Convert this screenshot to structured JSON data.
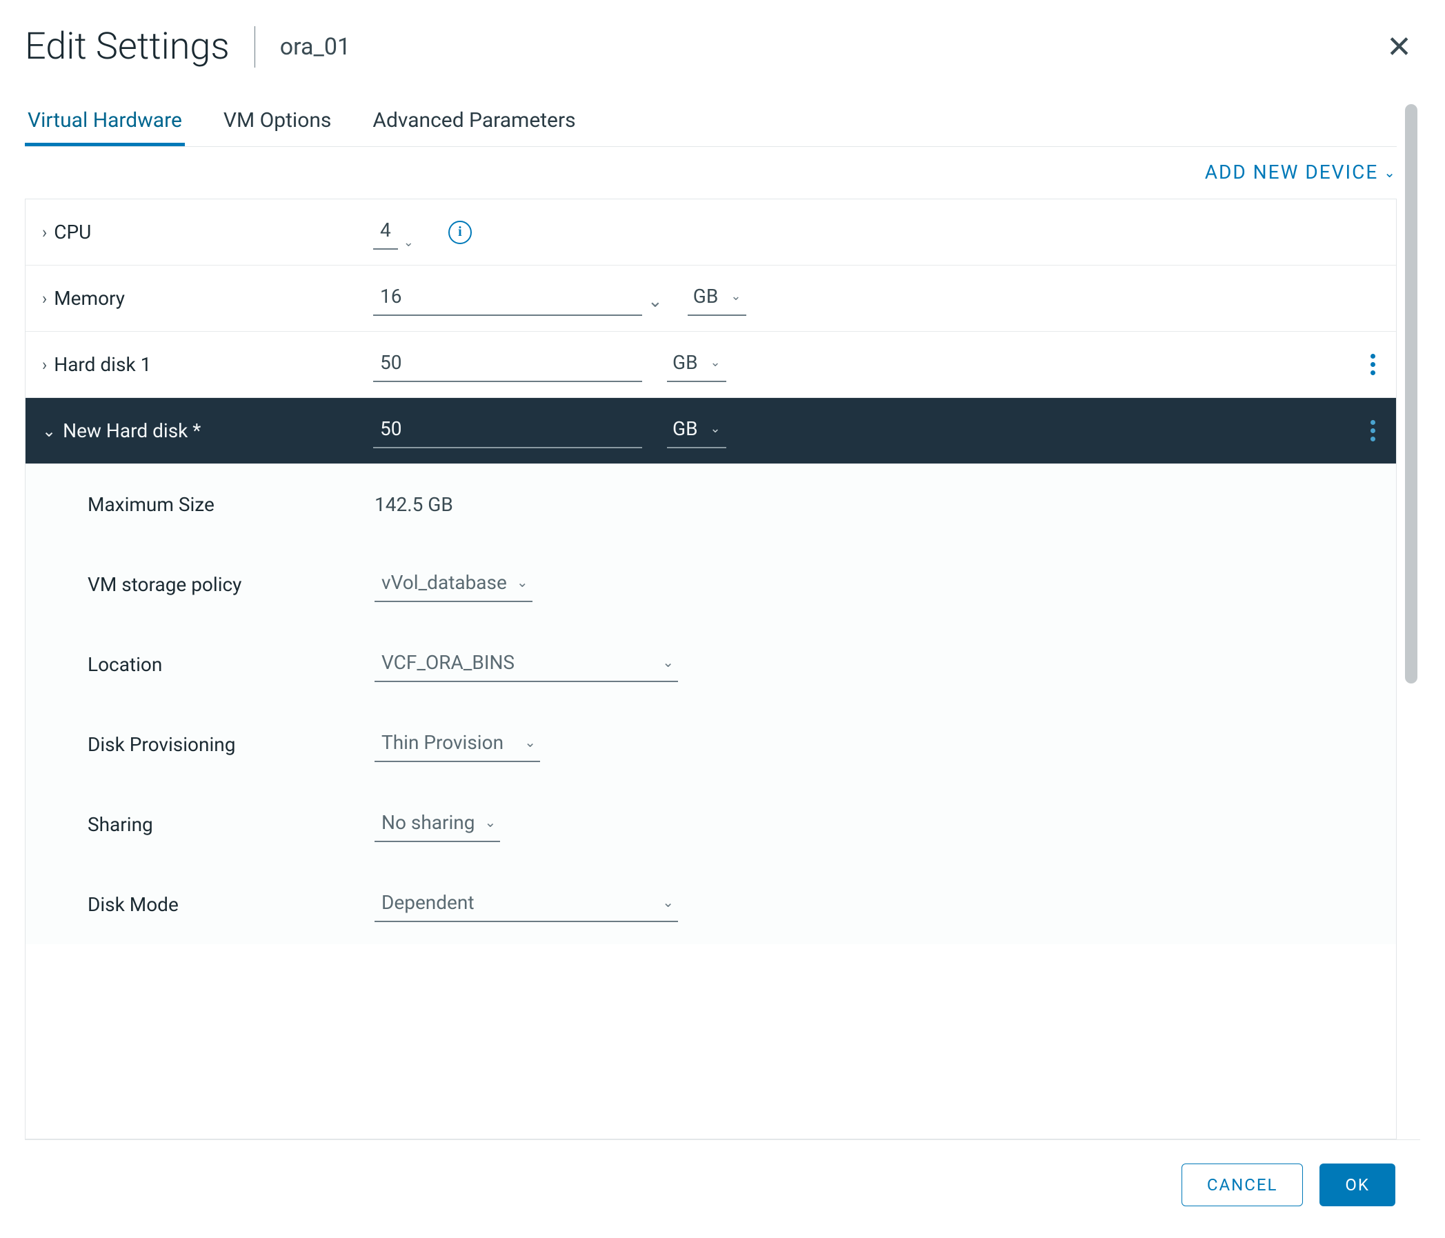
{
  "header": {
    "title": "Edit Settings",
    "target": "ora_01"
  },
  "tabs": {
    "virtual_hardware": "Virtual Hardware",
    "vm_options": "VM Options",
    "advanced_params": "Advanced Parameters"
  },
  "actions": {
    "add_device": "ADD NEW DEVICE"
  },
  "devices": {
    "cpu": {
      "label": "CPU",
      "count": "4"
    },
    "memory": {
      "label": "Memory",
      "size": "16",
      "unit": "GB"
    },
    "hd1": {
      "label": "Hard disk 1",
      "size": "50",
      "unit": "GB"
    },
    "newhd": {
      "label": "New Hard disk *",
      "size": "50",
      "unit": "GB"
    }
  },
  "newhd_details": {
    "max_size": {
      "label": "Maximum Size",
      "value": "142.5 GB"
    },
    "policy": {
      "label": "VM storage policy",
      "value": "vVol_database"
    },
    "location": {
      "label": "Location",
      "value": "VCF_ORA_BINS"
    },
    "provisioning": {
      "label": "Disk Provisioning",
      "value": "Thin Provision"
    },
    "sharing": {
      "label": "Sharing",
      "value": "No sharing"
    },
    "mode": {
      "label": "Disk Mode",
      "value": "Dependent"
    }
  },
  "footer": {
    "cancel": "CANCEL",
    "ok": "OK"
  }
}
